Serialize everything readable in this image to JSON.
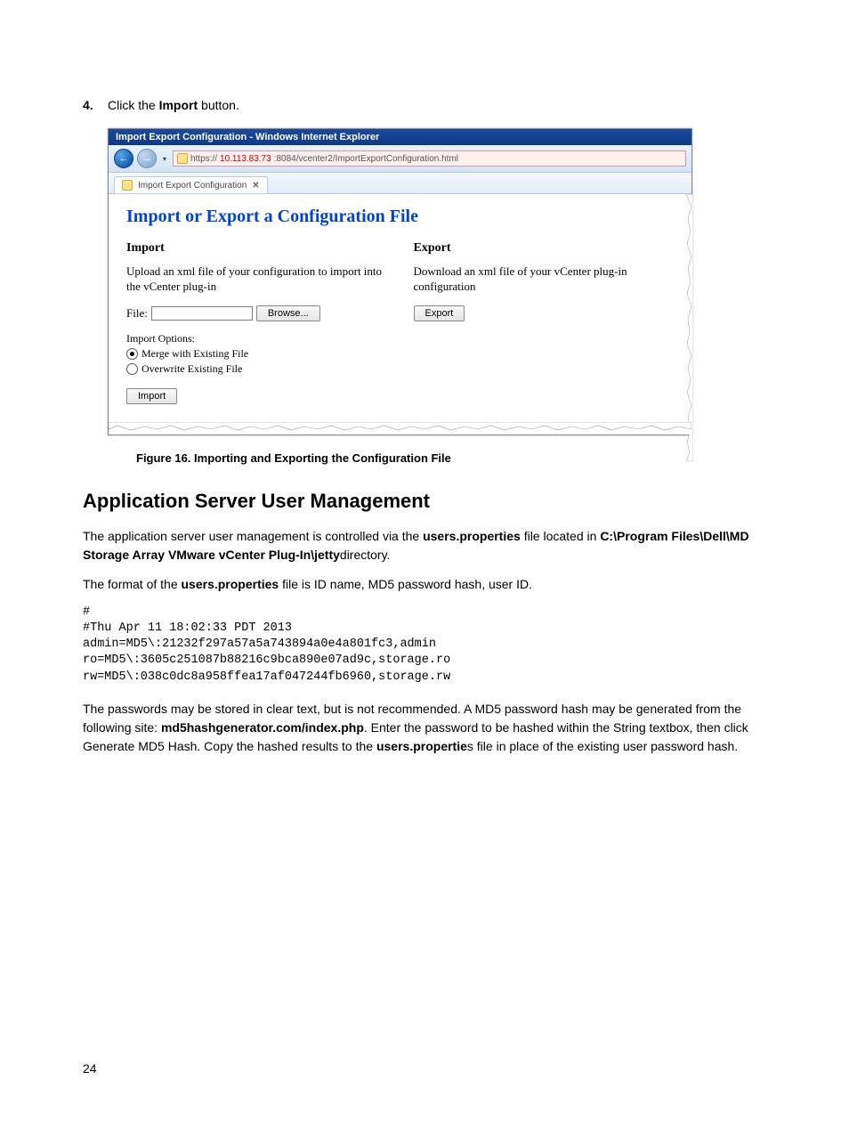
{
  "step": {
    "number": "4.",
    "prefix": "Click the ",
    "bold": "Import",
    "suffix": " button."
  },
  "ie": {
    "title": "Import Export Configuration - Windows Internet Explorer",
    "url_prefix": "https://",
    "url_host": "10.113.83.73",
    "url_rest": ":8084/vcenter2/ImportExportConfiguration.html",
    "tab_label": "Import Export Configuration",
    "heading": "Import or Export a Configuration File",
    "import": {
      "title": "Import",
      "desc": "Upload an xml file of your configuration to import into the vCenter plug-in",
      "file_label": "File:",
      "browse": "Browse...",
      "options_label": "Import Options:",
      "opt_merge": "Merge with Existing File",
      "opt_overwrite": "Overwrite Existing File",
      "button": "Import"
    },
    "export": {
      "title": "Export",
      "desc": "Download an xml file of your vCenter plug-in configuration",
      "button": "Export"
    }
  },
  "caption": "Figure 16. Importing and Exporting the Configuration File",
  "section_title": "Application Server User Management",
  "p1_a": "The application server user management is controlled via the ",
  "p1_b": "users.properties",
  "p1_c": " file located in ",
  "p1_d": "C:\\Program Files\\Dell\\MD Storage Array VMware vCenter Plug-In\\jetty",
  "p1_e": "directory.",
  "p2_a": "The format of the ",
  "p2_b": "users.properties",
  "p2_c": " file is ID name, MD5 password hash, user ID.",
  "code": "#\n#Thu Apr 11 18:02:33 PDT 2013\nadmin=MD5\\:21232f297a57a5a743894a0e4a801fc3,admin\nro=MD5\\:3605c251087b88216c9bca890e07ad9c,storage.ro\nrw=MD5\\:038c0dc8a958ffea17af047244fb6960,storage.rw",
  "p3_a": "The passwords may be stored in clear text, but is not recommended. A MD5 password hash may be generated from the following site: ",
  "p3_b": "md5hashgenerator.com/index.php",
  "p3_c": ". Enter the password to be hashed within the String textbox, then click Generate MD5 Hash. Copy the hashed results to the ",
  "p3_d": "users.propertie",
  "p3_e": "s file in place of the existing user password hash.",
  "page_number": "24"
}
